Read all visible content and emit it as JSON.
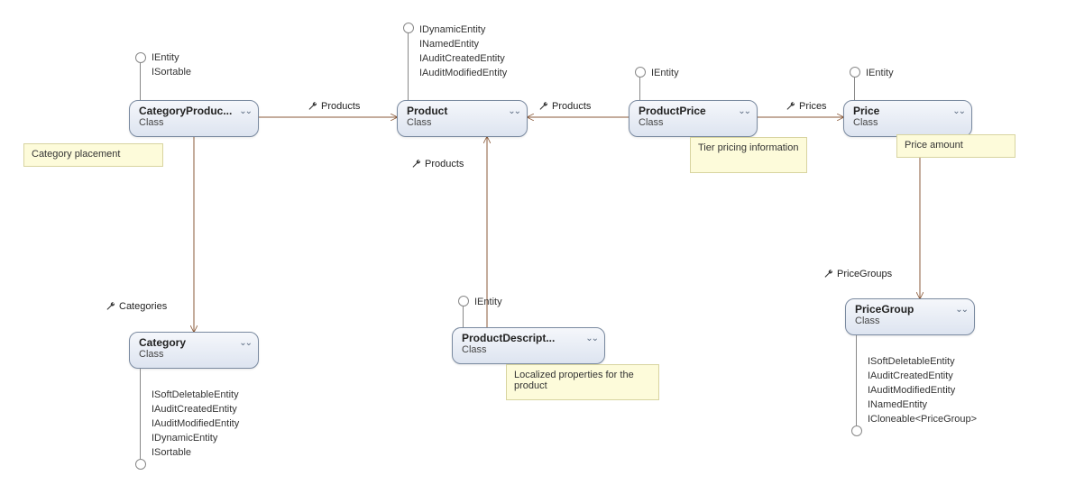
{
  "classes": {
    "categoryProduct": {
      "title": "CategoryProduc...",
      "sub": "Class"
    },
    "product": {
      "title": "Product",
      "sub": "Class"
    },
    "productPrice": {
      "title": "ProductPrice",
      "sub": "Class"
    },
    "price": {
      "title": "Price",
      "sub": "Class"
    },
    "category": {
      "title": "Category",
      "sub": "Class"
    },
    "productDescription": {
      "title": "ProductDescript...",
      "sub": "Class"
    },
    "priceGroup": {
      "title": "PriceGroup",
      "sub": "Class"
    }
  },
  "notes": {
    "categoryPlacement": "Category placement",
    "tierPricing": "Tier pricing information",
    "priceAmount": "Price amount",
    "localizedProps": "Localized properties for the product"
  },
  "interfaces": {
    "categoryProduct": [
      "IEntity",
      "ISortable"
    ],
    "product": [
      "IDynamicEntity",
      "INamedEntity",
      "IAuditCreatedEntity",
      "IAuditModifiedEntity"
    ],
    "productPrice": [
      "IEntity"
    ],
    "price": [
      "IEntity"
    ],
    "productDescription": [
      "IEntity"
    ],
    "category": [
      "ISoftDeletableEntity",
      "IAuditCreatedEntity",
      "IAuditModifiedEntity",
      "IDynamicEntity",
      "ISortable"
    ],
    "priceGroup": [
      "ISoftDeletableEntity",
      "IAuditCreatedEntity",
      "IAuditModifiedEntity",
      "INamedEntity",
      "ICloneable<PriceGroup>"
    ]
  },
  "associations": {
    "productsLeft": "Products",
    "productsRight": "Products",
    "productsBottom": "Products",
    "prices": "Prices",
    "categories": "Categories",
    "priceGroups": "PriceGroups"
  }
}
